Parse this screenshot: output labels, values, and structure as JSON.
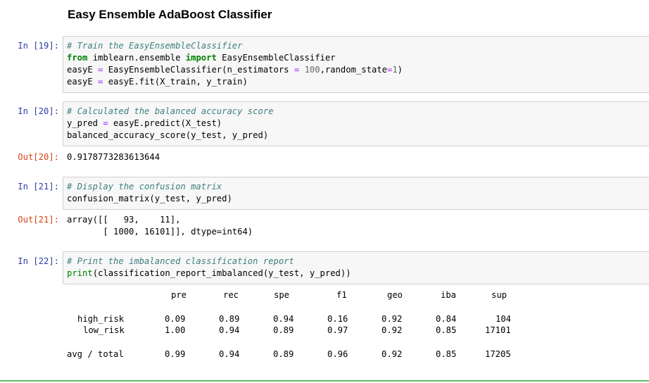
{
  "heading": "Easy Ensemble AdaBoost Classifier",
  "cells": {
    "c19": {
      "prompt": "In [19]:",
      "line1": "# Train the EasyEnsembleClassifier",
      "line2": {
        "kw1": "from",
        "mod": " imblearn.ensemble ",
        "kw2": "import",
        "rest": " EasyEnsembleClassifier"
      },
      "line3": {
        "a": "easyE ",
        "eq": "=",
        "b": " EasyEnsembleClassifier(n_estimators ",
        "eq2": "=",
        "sp": " ",
        "n1": "100",
        "c": ",random_state",
        "eq3": "=",
        "n2": "1",
        "d": ")"
      },
      "line4": {
        "a": "easyE ",
        "eq": "=",
        "b": " easyE.fit(X_train, y_train)"
      }
    },
    "c20": {
      "prompt": "In [20]:",
      "line1": "# Calculated the balanced accuracy score",
      "line2": {
        "a": "y_pred ",
        "eq": "=",
        "b": " easyE.predict(X_test)"
      },
      "line3": "balanced_accuracy_score(y_test, y_pred)",
      "out_prompt": "Out[20]:",
      "output": "0.9178773283613644"
    },
    "c21": {
      "prompt": "In [21]:",
      "line1": "# Display the confusion matrix",
      "line2": "confusion_matrix(y_test, y_pred)",
      "out_prompt": "Out[21]:",
      "output1": "array([[   93,    11],",
      "output2": "       [ 1000, 16101]], dtype=int64)"
    },
    "c22": {
      "prompt": "In [22]:",
      "line1": "# Print the imbalanced classification report",
      "line2": {
        "fn": "print",
        "rest": "(classification_report_imbalanced(y_test, y_pred))"
      }
    }
  },
  "report": {
    "headers": [
      "pre",
      "rec",
      "spe",
      "f1",
      "geo",
      "iba",
      "sup"
    ],
    "rows": [
      {
        "label": "high_risk",
        "values": [
          "0.09",
          "0.89",
          "0.94",
          "0.16",
          "0.92",
          "0.84",
          "104"
        ]
      },
      {
        "label": "low_risk",
        "values": [
          "1.00",
          "0.94",
          "0.89",
          "0.97",
          "0.92",
          "0.85",
          "17101"
        ]
      },
      {
        "label": "avg / total",
        "values": [
          "0.99",
          "0.94",
          "0.89",
          "0.96",
          "0.92",
          "0.85",
          "17205"
        ]
      }
    ]
  },
  "colors": {
    "prompt_in": "#303f9f",
    "prompt_out": "#d84315",
    "comment": "#408080",
    "keyword": "#008000",
    "operator": "#aa22ff",
    "number": "#666666"
  }
}
